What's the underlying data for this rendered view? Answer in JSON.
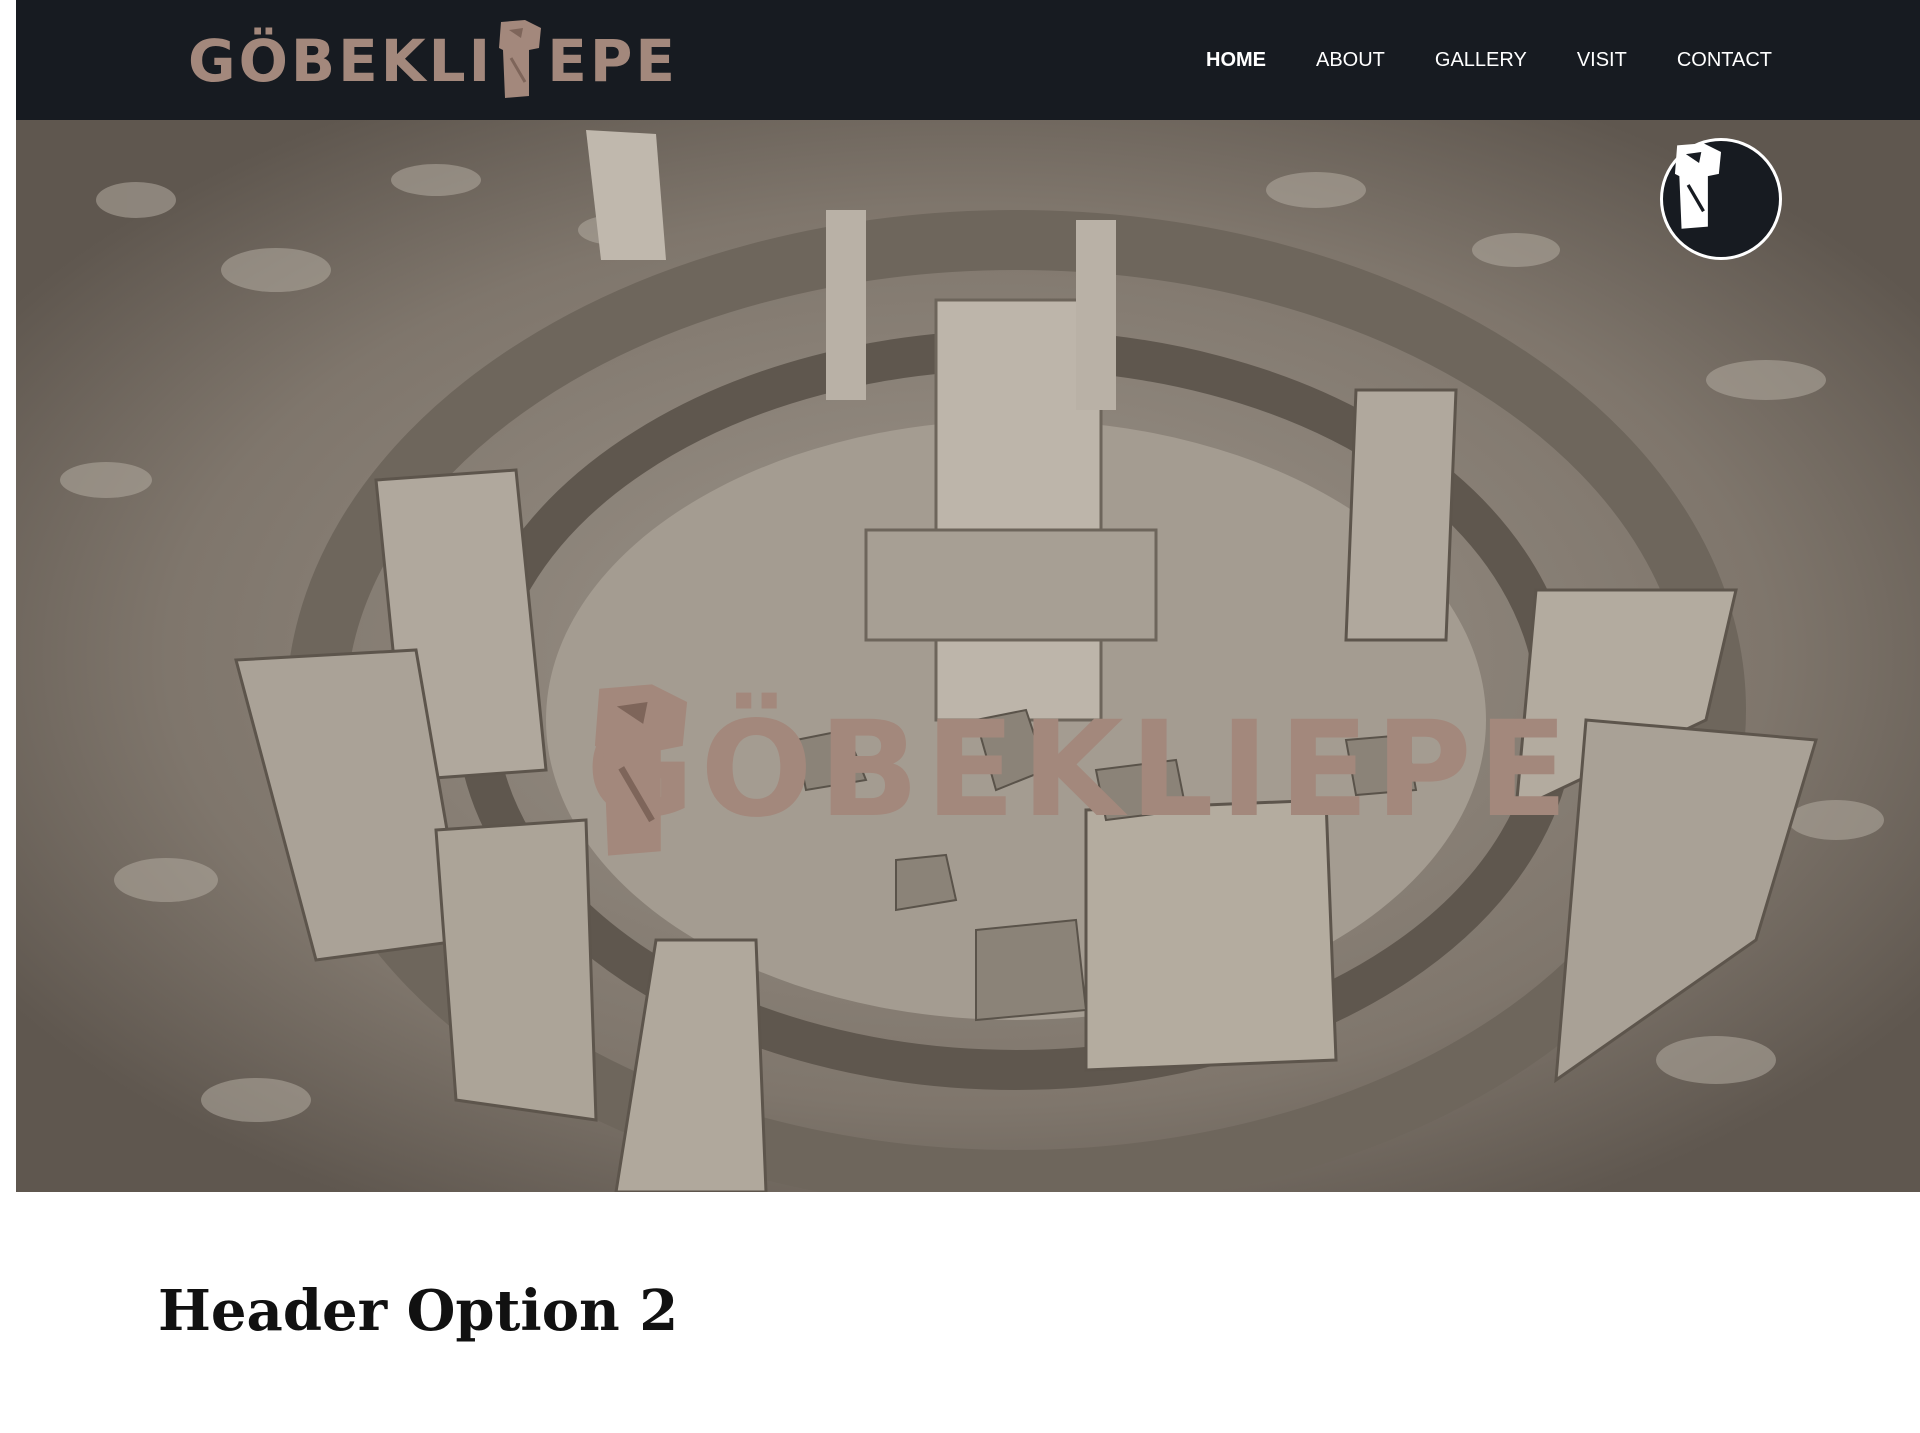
{
  "header": {
    "logo_text_left": "GÖBEKLI",
    "logo_text_right": "EPE",
    "logo_alt": "GÖBEKLI TEPE",
    "background_color": "#171b21",
    "logo_color": "#a3887c"
  },
  "nav": {
    "items": [
      {
        "label": "HOME",
        "active": true
      },
      {
        "label": "ABOUT",
        "active": false
      },
      {
        "label": "GALLERY",
        "active": false
      },
      {
        "label": "VISIT",
        "active": false
      },
      {
        "label": "CONTACT",
        "active": false
      }
    ]
  },
  "hero": {
    "logo_text_left": "GÖBEKLI",
    "logo_text_right": "EPE",
    "badge_icon": "pillar-icon"
  },
  "main": {
    "section_title": "Header Option 2"
  }
}
